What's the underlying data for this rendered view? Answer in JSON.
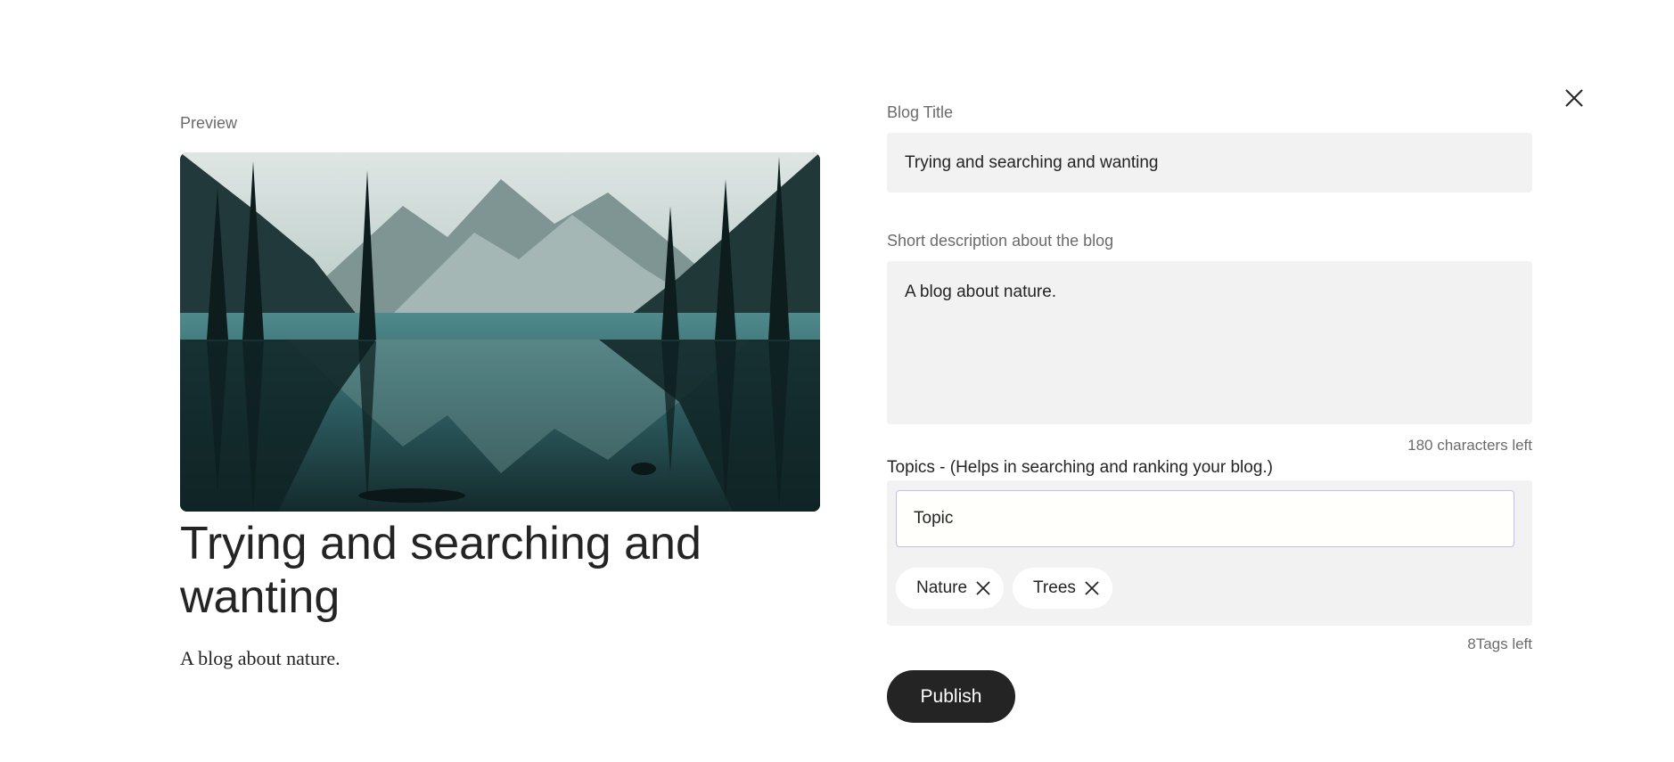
{
  "preview": {
    "label": "Preview",
    "title": "Trying and searching and wanting",
    "description": "A blog about nature."
  },
  "form": {
    "title_label": "Blog Title",
    "title_value": "Trying and searching and wanting",
    "description_label": "Short description about the blog",
    "description_value": "A blog about nature.",
    "description_counter": "180 characters left",
    "topics_label": "Topics - (Helps in searching and ranking your blog.)",
    "topic_input_value": "Topic",
    "tags": [
      {
        "label": "Nature"
      },
      {
        "label": "Trees"
      }
    ],
    "tags_counter": "8Tags left",
    "publish_label": "Publish"
  },
  "icons": {
    "close": "close-icon",
    "tag_remove": "close-icon"
  },
  "colors": {
    "text": "#242424",
    "muted": "#6b6b6b",
    "field_bg": "#f2f2f2",
    "focus_border": "#c7b9f4",
    "button_bg": "#242424"
  }
}
